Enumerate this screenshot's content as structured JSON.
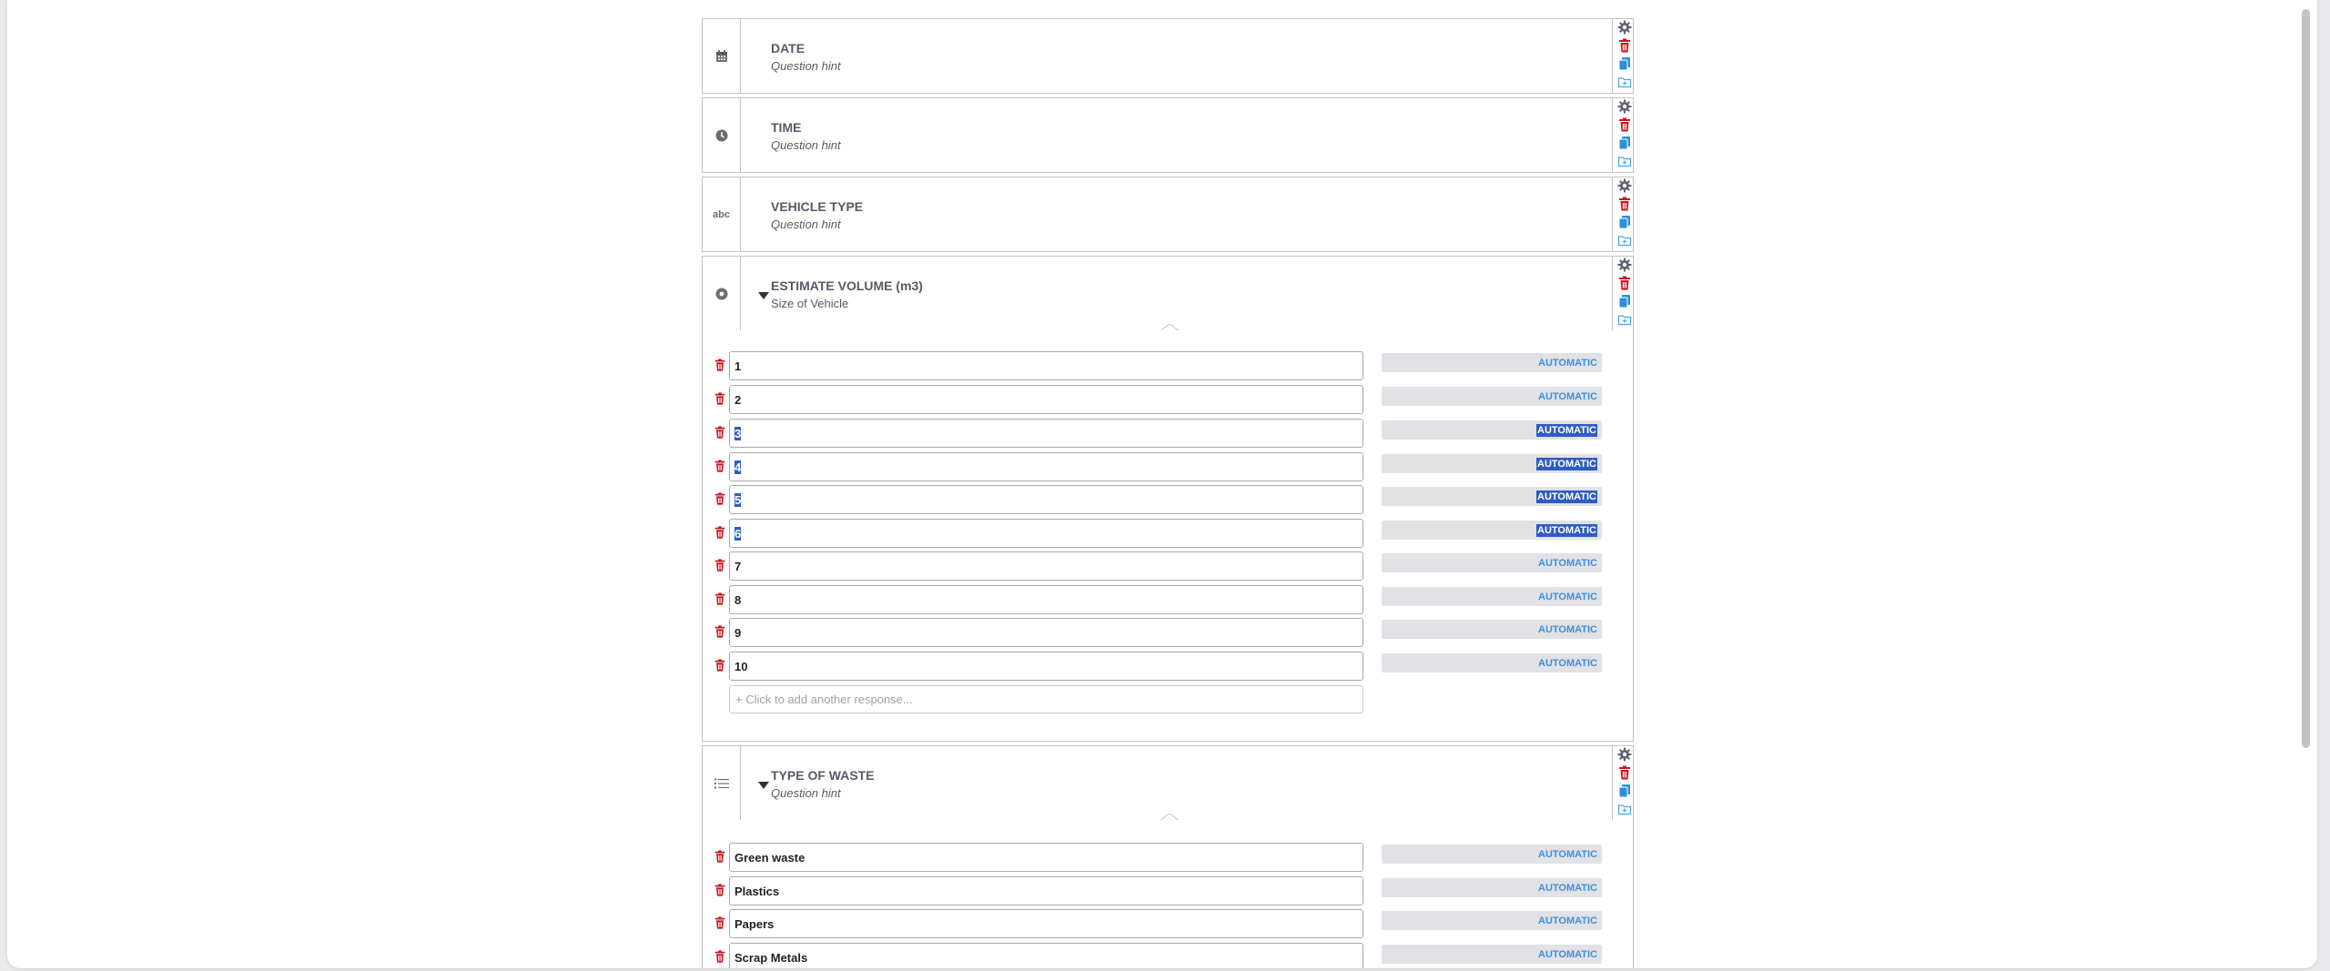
{
  "colors": {
    "trash": "#c8161d",
    "copy": "#2d8fd8",
    "gear": "#5d6270",
    "automatic_text": "#3f8fdc",
    "selection": "#2e5dc2"
  },
  "questions": [
    {
      "type_icon": "calendar-icon",
      "title": "DATE",
      "hint": "Question hint"
    },
    {
      "type_icon": "clock-icon",
      "title": "TIME",
      "hint": "Question hint"
    },
    {
      "type_icon": "text-abc-icon",
      "icon_text": "abc",
      "title": "VEHICLE TYPE",
      "hint": "Question hint"
    },
    {
      "type_icon": "radio-icon",
      "title": "ESTIMATE VOLUME (m3)",
      "subtitle": "Size of Vehicle"
    },
    {
      "type_icon": "list-icon",
      "title": "TYPE OF WASTE",
      "hint": "Question hint"
    }
  ],
  "volume_options": [
    {
      "label": "1",
      "score": "AUTOMATIC",
      "selected": false
    },
    {
      "label": "2",
      "score": "AUTOMATIC",
      "selected": false
    },
    {
      "label": "3",
      "score": "AUTOMATIC",
      "selected": true
    },
    {
      "label": "4",
      "score": "AUTOMATIC",
      "selected": true
    },
    {
      "label": "5",
      "score": "AUTOMATIC",
      "selected": true
    },
    {
      "label": "6",
      "score": "AUTOMATIC",
      "selected": true
    },
    {
      "label": "7",
      "score": "AUTOMATIC",
      "selected": false
    },
    {
      "label": "8",
      "score": "AUTOMATIC",
      "selected": false
    },
    {
      "label": "9",
      "score": "AUTOMATIC",
      "selected": false
    },
    {
      "label": "10",
      "score": "AUTOMATIC",
      "selected": false
    }
  ],
  "add_response_placeholder": "+ Click to add another response...",
  "waste_options": [
    {
      "label": "Green waste",
      "score": "AUTOMATIC"
    },
    {
      "label": "Plastics",
      "score": "AUTOMATIC"
    },
    {
      "label": "Papers",
      "score": "AUTOMATIC"
    },
    {
      "label": "Scrap Metals",
      "score": "AUTOMATIC"
    }
  ]
}
